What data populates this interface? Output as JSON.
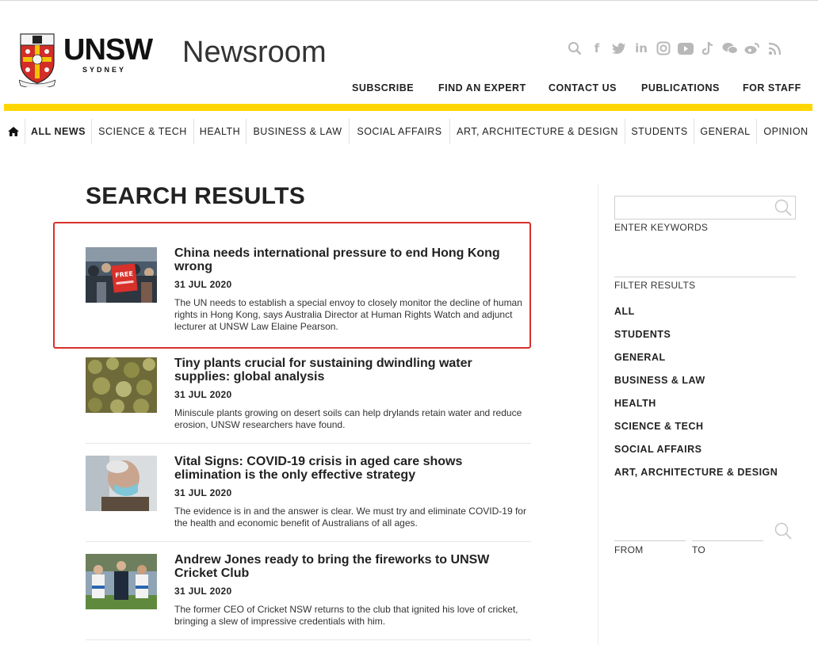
{
  "brand": {
    "name": "UNSW",
    "subname": "SYDNEY",
    "section": "Newsroom",
    "crest_motto": "MANU ET MENTE"
  },
  "social_icons": [
    "search-icon",
    "facebook-icon",
    "twitter-icon",
    "linkedin-icon",
    "instagram-icon",
    "youtube-icon",
    "tiktok-icon",
    "wechat-icon",
    "weibo-icon",
    "rss-icon"
  ],
  "util_nav": [
    "SUBSCRIBE",
    "FIND AN EXPERT",
    "CONTACT US",
    "PUBLICATIONS",
    "FOR STAFF"
  ],
  "main_nav": [
    "ALL NEWS",
    "SCIENCE & TECH",
    "HEALTH",
    "BUSINESS & LAW",
    "SOCIAL AFFAIRS",
    "ART, ARCHITECTURE & DESIGN",
    "STUDENTS",
    "GENERAL",
    "OPINION"
  ],
  "page_title": "SEARCH RESULTS",
  "results": [
    {
      "title": "China needs international pressure to end Hong Kong wrong",
      "date": "31 JUL 2020",
      "desc": "The UN needs to establish a special envoy to closely monitor the decline of human rights in Hong Kong, says Australia Director at Human Rights Watch and adjunct lecturer at UNSW Law Elaine Pearson.",
      "thumb_sign": "FREE"
    },
    {
      "title": "Tiny plants crucial for sustaining dwindling water supplies: global analysis",
      "date": "31 JUL 2020",
      "desc": "Miniscule plants growing on desert soils can help drylands retain water and reduce erosion, UNSW researchers have found."
    },
    {
      "title": "Vital Signs: COVID-19 crisis in aged care shows elimination is the only effective strategy",
      "date": "31 JUL 2020",
      "desc": "The evidence is in and the answer is clear. We must try and eliminate COVID-19 for the health and economic benefit of Australians of all ages."
    },
    {
      "title": "Andrew Jones ready to bring the fireworks to UNSW Cricket Club",
      "date": "31 JUL 2020",
      "desc": "The former CEO of Cricket NSW returns to the club that ignited his love of cricket, bringing a slew of impressive credentials with him."
    }
  ],
  "sidebar": {
    "search_placeholder": "",
    "enter_keywords": "ENTER KEYWORDS",
    "filter_results": "FILTER RESULTS",
    "filters": [
      "ALL",
      "STUDENTS",
      "GENERAL",
      "BUSINESS & LAW",
      "HEALTH",
      "SCIENCE & TECH",
      "SOCIAL AFFAIRS",
      "ART, ARCHITECTURE & DESIGN"
    ],
    "from": "FROM",
    "to": "TO"
  },
  "colors": {
    "accent_yellow": "#ffd600",
    "highlight_red": "#d8312b",
    "icon_grey": "#b8b8b8"
  }
}
